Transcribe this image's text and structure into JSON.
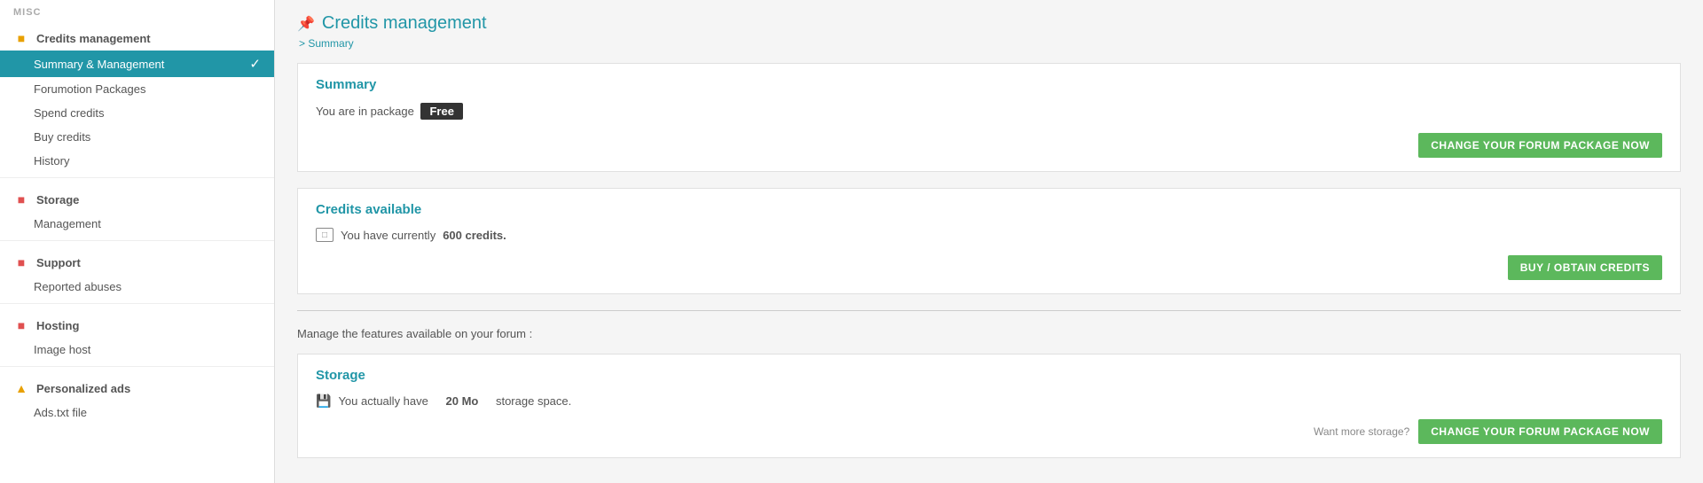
{
  "sidebar": {
    "misc_label": "MISC",
    "credits_management": "Credits management",
    "items_misc": [
      {
        "label": "Summary & Management",
        "active": true
      },
      {
        "label": "Forumotion Packages",
        "active": false
      },
      {
        "label": "Spend credits",
        "active": false
      },
      {
        "label": "Buy credits",
        "active": false
      },
      {
        "label": "History",
        "active": false
      }
    ],
    "storage_label": "Storage",
    "items_storage": [
      {
        "label": "Management",
        "active": false
      }
    ],
    "support_label": "Support",
    "items_support": [
      {
        "label": "Reported abuses",
        "active": false
      }
    ],
    "hosting_label": "Hosting",
    "items_hosting": [
      {
        "label": "Image host",
        "active": false
      }
    ],
    "personalized_ads_label": "Personalized ads",
    "items_ads": [
      {
        "label": "Ads.txt file",
        "active": false
      }
    ]
  },
  "main": {
    "page_title": "Credits management",
    "breadcrumb": "Summary",
    "summary_header": "Summary",
    "package_text_before": "You are in package",
    "package_name": "Free",
    "change_package_btn": "CHANGE YOUR FORUM PACKAGE NOW",
    "credits_header": "Credits available",
    "credits_text_before": "You have currently",
    "credits_amount": "600 credits.",
    "buy_credits_btn": "BUY / OBTAIN CREDITS",
    "manage_label": "Manage the features available on your forum :",
    "storage_header": "Storage",
    "storage_text_before": "You actually have",
    "storage_amount": "20 Mo",
    "storage_text_after": "storage space.",
    "want_more_label": "Want more storage?",
    "change_package_btn2": "CHANGE YOUR FORUM PACKAGE NOW"
  }
}
